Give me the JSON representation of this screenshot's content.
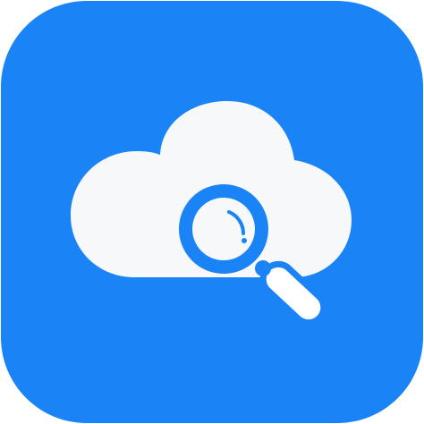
{
  "icon": {
    "name": "cloud-search-app-icon",
    "glyphs": [
      "cloud-icon",
      "magnifier-icon"
    ]
  },
  "colors": {
    "tile": "#1a83f6",
    "cloud": "#f7f8fa",
    "magnifier": "#1a83f6",
    "lens_fill": "#f7f8fa",
    "handle_fill": "#ffffff",
    "border": "#ffffff"
  }
}
